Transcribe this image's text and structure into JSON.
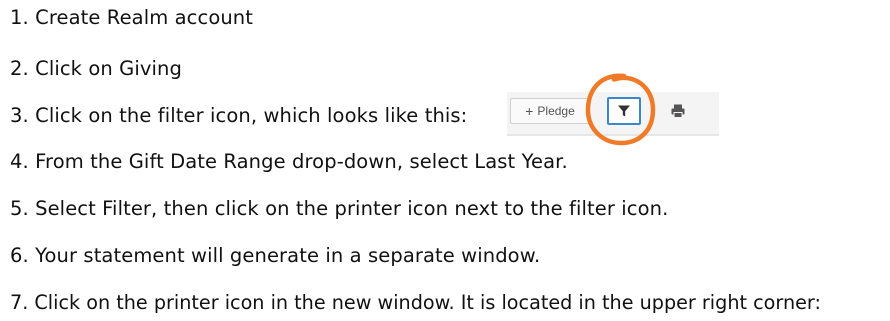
{
  "steps": [
    "1. Create Realm account",
    "2. Click on Giving",
    "3. Click on the filter icon, which looks like this:",
    "4. From the Gift Date Range drop-down, select Last Year.",
    "5. Select Filter, then click on the printer icon next to the filter icon.",
    "6. Your statement will generate in a separate window.",
    "7. Click on the printer icon in the new window.  It is located in the upper right corner:"
  ],
  "toolbar": {
    "pledge_label": "Pledge",
    "pledge_icon": "plus-icon",
    "filter_icon": "filter-icon",
    "print_icon": "printer-icon"
  },
  "colors": {
    "highlight_circle": "#f07a28",
    "filter_border": "#3a87c9",
    "text": "#111111"
  }
}
